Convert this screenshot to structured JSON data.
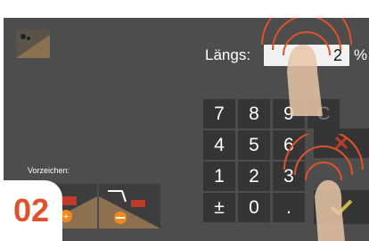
{
  "laengs": {
    "label": "Längs:",
    "value": "2",
    "unit": "%"
  },
  "keypad": {
    "keys": [
      "7",
      "8",
      "9",
      "C",
      "4",
      "5",
      "6",
      "1",
      "2",
      "3",
      "±",
      "0",
      "."
    ]
  },
  "sign": {
    "label": "Vorzeichen:"
  },
  "badge": "02",
  "colors": {
    "accent": "#e0522b",
    "ok": "#c8b84a",
    "x": "#c0392b"
  }
}
